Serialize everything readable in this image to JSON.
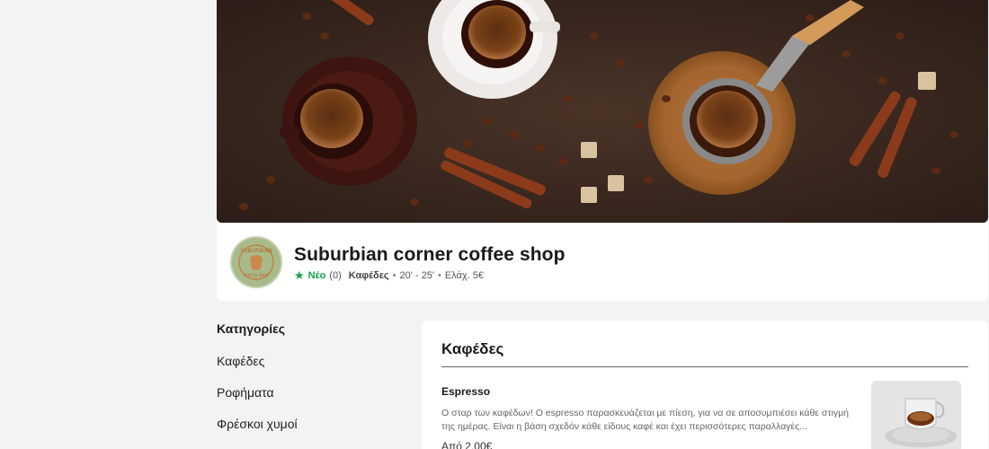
{
  "store": {
    "name": "Suburbian corner coffee shop",
    "new_label": "Νέο",
    "rating_count": "(0)",
    "category": "Καφέδες",
    "delivery_time": "20' - 25'",
    "min_order": "Ελάχ. 5€",
    "separator": "•"
  },
  "sidebar": {
    "heading": "Κατηγορίες",
    "items": [
      {
        "label": "Καφέδες"
      },
      {
        "label": "Ροφήματα"
      },
      {
        "label": "Φρέσκοι χυμοί"
      }
    ]
  },
  "menu": {
    "section_title": "Καφέδες",
    "items": [
      {
        "name": "Espresso",
        "description": "Ο σταρ των καφέδων! Ο espresso παρασκευάζεται με πίεση, για να σε αποσυμπιέσει κάθε στιγμή της ημέρας. Είναι η βάση σχεδόν κάθε είδους καφέ και έχει περισσότερες παραλλαγές...",
        "price": "Από 2,00€"
      }
    ]
  },
  "colors": {
    "accent_green": "#16a34a",
    "background": "#f3f3f3"
  },
  "icons": {
    "rating": "star-icon"
  }
}
